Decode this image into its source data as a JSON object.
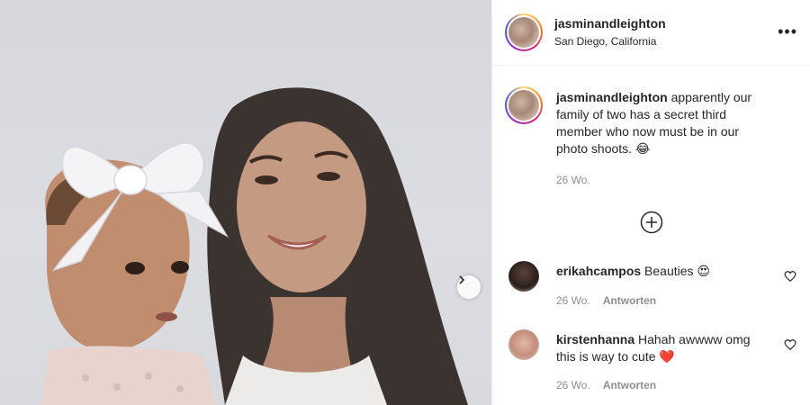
{
  "post": {
    "author": "jasminandleighton",
    "location": "San Diego, California",
    "more_icon": "•••"
  },
  "caption": {
    "username": "jasminandleighton",
    "text": " apparently our family of two has a secret third member who now must be in our photo shoots. 😂",
    "time": "26 Wo."
  },
  "comments": [
    {
      "username": "erikahcampos",
      "text": " Beauties 😍",
      "time": "26 Wo.",
      "reply_label": "Antworten"
    },
    {
      "username": "kirstenhanna",
      "text": " Hahah awwww omg this is way to cute ❤️",
      "time": "26 Wo.",
      "reply_label": "Antworten"
    }
  ],
  "icons": {
    "next": "chevron-right-icon",
    "load_more": "plus-circle-icon",
    "like": "heart-icon"
  }
}
